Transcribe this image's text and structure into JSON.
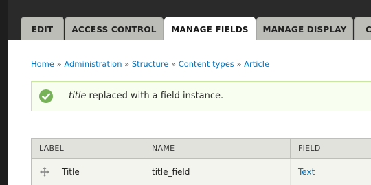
{
  "tabs": [
    {
      "label": "EDIT",
      "active": false
    },
    {
      "label": "ACCESS CONTROL",
      "active": false
    },
    {
      "label": "MANAGE FIELDS",
      "active": true
    },
    {
      "label": "MANAGE DISPLAY",
      "active": false
    },
    {
      "label": "C",
      "active": false
    }
  ],
  "breadcrumb": {
    "items": [
      "Home",
      "Administration",
      "Structure",
      "Content types",
      "Article"
    ],
    "separator": "»"
  },
  "status": {
    "emphasis": "title",
    "message": " replaced with a field instance.",
    "type": "success",
    "icon": "check-circle-icon"
  },
  "table": {
    "headers": [
      "LABEL",
      "NAME",
      "FIELD"
    ],
    "rows": [
      {
        "label": "Title",
        "name": "title_field",
        "field": "Text"
      }
    ]
  },
  "colors": {
    "link": "#0074bd",
    "success": "#77b259",
    "tab_inactive": "#bdbdb7",
    "header_row": "#e1e2dc"
  }
}
